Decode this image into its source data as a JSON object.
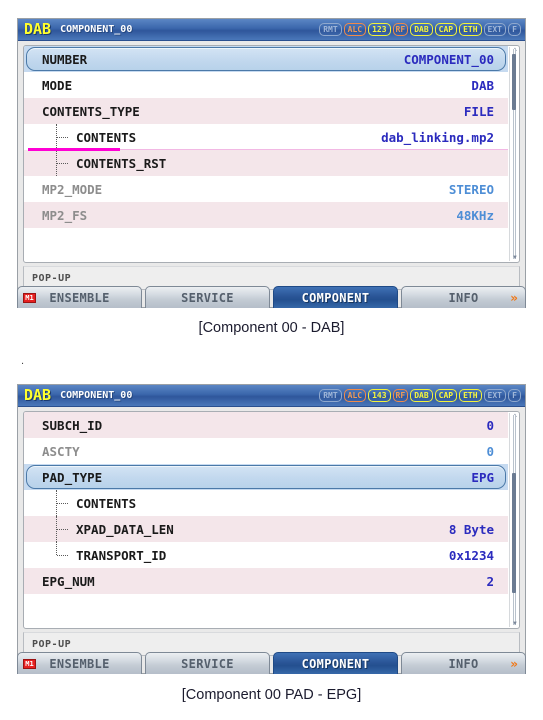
{
  "panels": [
    {
      "titlebar": {
        "logo": "DAB",
        "name": "COMPONENT_00",
        "badges": [
          {
            "label": "RMT",
            "state": "off"
          },
          {
            "label": "ALC",
            "state": "orange"
          },
          {
            "label": "123",
            "state": "yellow"
          },
          {
            "label": "RF",
            "state": "orange"
          },
          {
            "label": "DAB",
            "state": "yellow"
          },
          {
            "label": "CAP",
            "state": "yellow"
          },
          {
            "label": "ETH",
            "state": "yellow"
          },
          {
            "label": "EXT",
            "state": "off"
          },
          {
            "label": "F",
            "state": "off"
          }
        ]
      },
      "rows": [
        {
          "key": "NUMBER",
          "value": "COMPONENT_00",
          "indent": 0,
          "bg": "white",
          "selected": true,
          "dim": false
        },
        {
          "key": "MODE",
          "value": "DAB",
          "indent": 0,
          "bg": "white",
          "selected": false,
          "dim": false
        },
        {
          "key": "CONTENTS_TYPE",
          "value": "FILE",
          "indent": 0,
          "bg": "pink",
          "selected": false,
          "dim": false
        },
        {
          "key": "CONTENTS",
          "value": "dab_linking.mp2",
          "indent": 1,
          "bg": "white",
          "selected": false,
          "dim": false,
          "underline": true
        },
        {
          "key": "CONTENTS_RST",
          "value": "",
          "indent": 1,
          "bg": "pink",
          "selected": false,
          "dim": false
        },
        {
          "key": "MP2_MODE",
          "value": "STEREO",
          "indent": 0,
          "bg": "white",
          "selected": false,
          "dim": true
        },
        {
          "key": "MP2_FS",
          "value": "48KHz",
          "indent": 0,
          "bg": "pink",
          "selected": false,
          "dim": true
        }
      ],
      "popup_label": "POP-UP",
      "tabs": [
        {
          "label": "ENSEMBLE",
          "active": false,
          "mini_icon": "M1",
          "arrow": false
        },
        {
          "label": "SERVICE",
          "active": false,
          "mini_icon": "",
          "arrow": false
        },
        {
          "label": "COMPONENT",
          "active": true,
          "mini_icon": "",
          "arrow": false
        },
        {
          "label": "INFO",
          "active": false,
          "mini_icon": "",
          "arrow": true
        }
      ],
      "caption": "[Component 00 - DAB]"
    },
    {
      "titlebar": {
        "logo": "DAB",
        "name": "COMPONENT_00",
        "badges": [
          {
            "label": "RMT",
            "state": "off"
          },
          {
            "label": "ALC",
            "state": "orange"
          },
          {
            "label": "143",
            "state": "yellow"
          },
          {
            "label": "RF",
            "state": "orange"
          },
          {
            "label": "DAB",
            "state": "yellow"
          },
          {
            "label": "CAP",
            "state": "yellow"
          },
          {
            "label": "ETH",
            "state": "yellow"
          },
          {
            "label": "EXT",
            "state": "off"
          },
          {
            "label": "F",
            "state": "off"
          }
        ]
      },
      "rows": [
        {
          "key": "SUBCH_ID",
          "value": "0",
          "indent": 0,
          "bg": "pink",
          "selected": false,
          "dim": false
        },
        {
          "key": "ASCTY",
          "value": "0",
          "indent": 0,
          "bg": "white",
          "selected": false,
          "dim": true
        },
        {
          "key": "PAD_TYPE",
          "value": "EPG",
          "indent": 0,
          "bg": "white",
          "selected": true,
          "dim": false
        },
        {
          "key": "CONTENTS",
          "value": "",
          "indent": 1,
          "bg": "white",
          "selected": false,
          "dim": false
        },
        {
          "key": "XPAD_DATA_LEN",
          "value": "8 Byte",
          "indent": 1,
          "bg": "pink",
          "selected": false,
          "dim": false
        },
        {
          "key": "TRANSPORT_ID",
          "value": "0x1234",
          "indent": 1,
          "bg": "white",
          "selected": false,
          "dim": false
        },
        {
          "key": "EPG_NUM",
          "value": "2",
          "indent": 0,
          "bg": "pink",
          "selected": false,
          "dim": false
        }
      ],
      "popup_label": "POP-UP",
      "tabs": [
        {
          "label": "ENSEMBLE",
          "active": false,
          "mini_icon": "M1",
          "arrow": false
        },
        {
          "label": "SERVICE",
          "active": false,
          "mini_icon": "",
          "arrow": false
        },
        {
          "label": "COMPONENT",
          "active": true,
          "mini_icon": "",
          "arrow": false
        },
        {
          "label": "INFO",
          "active": false,
          "mini_icon": "",
          "arrow": true
        }
      ],
      "caption": "[Component 00 PAD - EPG]"
    }
  ],
  "separator_mark": ".",
  "colors": {
    "titlebar_blue": "#2f569b",
    "logo_yellow": "#ffff2e",
    "row_pink": "#f4e6ea",
    "row_white": "#ffffff",
    "value_blue": "#2b2bbe",
    "value_dim_blue": "#4e8ed6",
    "selection_blue": "#c6daf0",
    "active_tab_blue": "#2a5597",
    "underline_magenta": "#ff00d4",
    "arrow_orange": "#f07818"
  }
}
